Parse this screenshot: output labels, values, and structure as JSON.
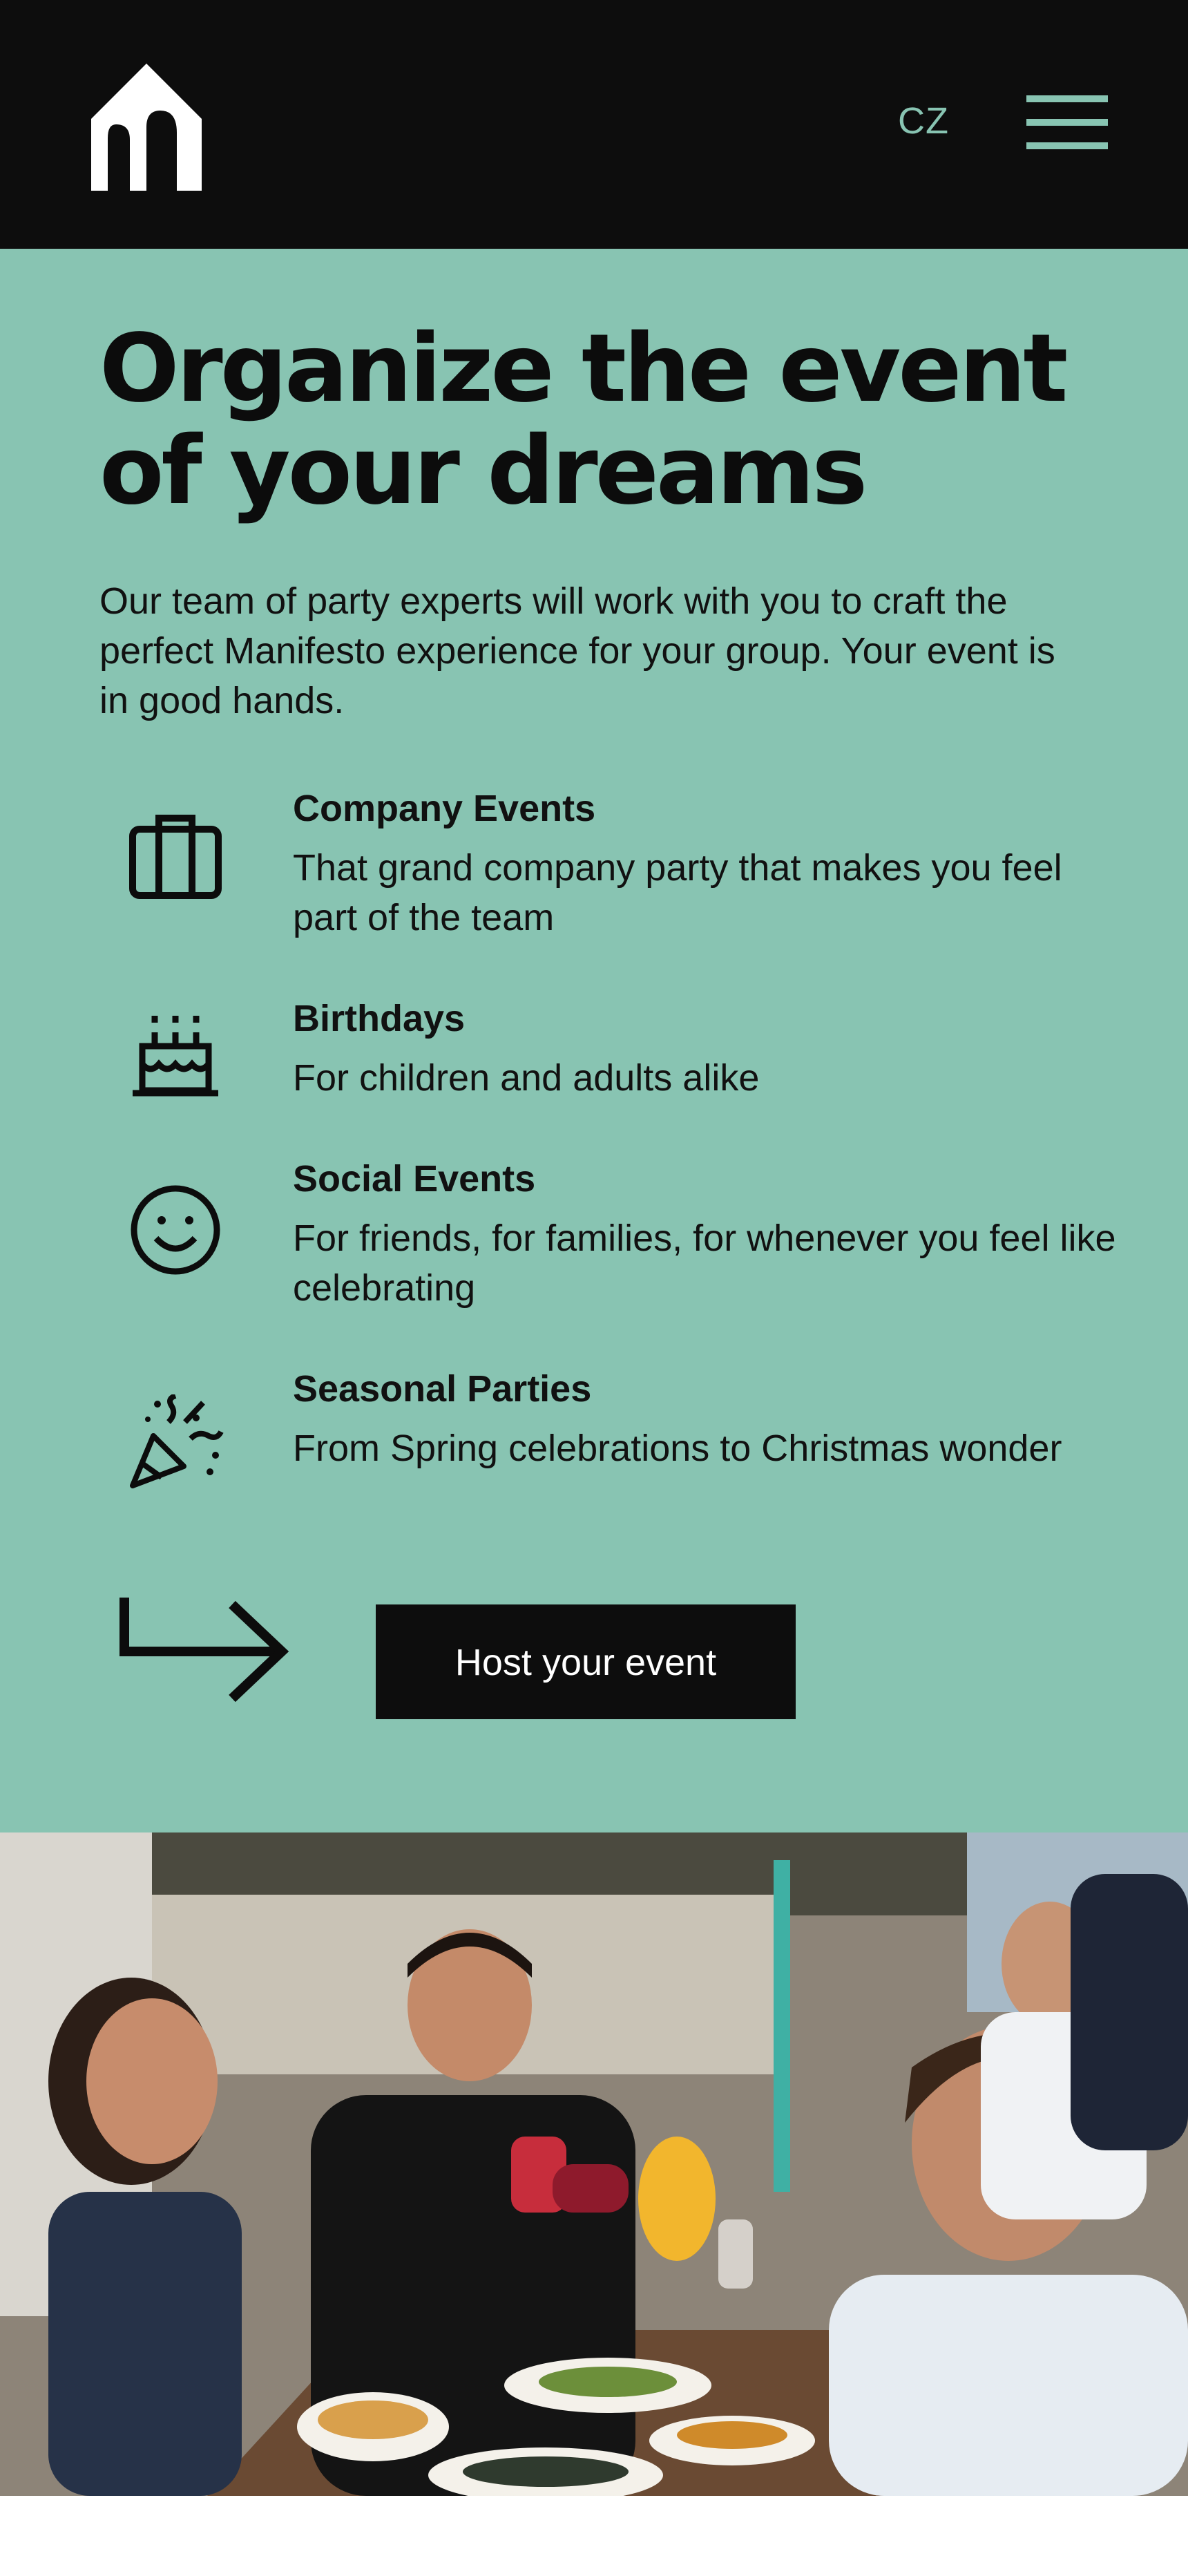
{
  "header": {
    "logo_icon": "house-arch-logo",
    "language_label": "CZ",
    "menu_icon": "hamburger-menu-icon",
    "background_color": "#0d0d0d",
    "accent_color": "#88c4b2"
  },
  "hero": {
    "title_line1": "Organize the event",
    "title_line2": "of your dreams",
    "intro": "Our team of party experts will work with you to craft the perfect Manifesto experience for your group. Your event is in good hands.",
    "background_color": "#88c4b2",
    "features": [
      {
        "icon": "briefcase-icon",
        "title": "Company Events",
        "description": "That grand company party that makes you feel part of the team"
      },
      {
        "icon": "birthday-cake-icon",
        "title": "Birthdays",
        "description": "For children and adults alike"
      },
      {
        "icon": "smiley-face-icon",
        "title": "Social Events",
        "description": "For friends, for families, for whenever you feel like celebrating"
      },
      {
        "icon": "party-popper-icon",
        "title": "Seasonal Parties",
        "description": "From Spring celebrations to Christmas wonder"
      }
    ],
    "cta_arrow_icon": "turn-right-arrow-icon",
    "cta_label": "Host your event"
  },
  "photo": {
    "subject": "friends-toasting-drinks-at-restaurant-photo"
  }
}
